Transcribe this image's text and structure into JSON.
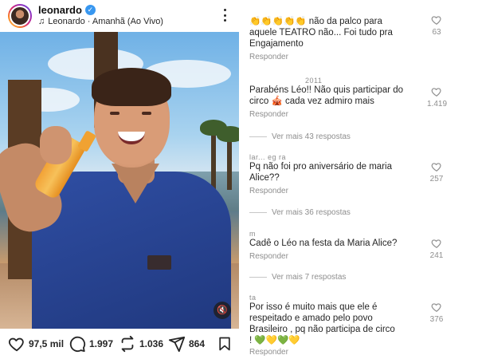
{
  "post": {
    "username": "leonardo",
    "music": "Leonardo · Amanhã (Ao Vivo)",
    "actions": {
      "likes": "97,5 mil",
      "comments": "1.997",
      "reposts": "1.036",
      "shares": "864"
    }
  },
  "comments": [
    {
      "user": "",
      "text": "👏👏👏👏👏 não da palco para aquele TEATRO não... Foi tudo pra Engajamento",
      "reply": "Responder",
      "likes": "63"
    },
    {
      "user": "2011",
      "text": "Parabéns Léo!! Não quis participar do circo 🎪 cada vez admiro mais",
      "reply": "Responder",
      "likes": "1.419",
      "more_replies": "Ver mais 43 respostas"
    },
    {
      "user": "lar... eg ra",
      "text": "Pq não foi pro aniversário de maria Alice??",
      "reply": "Responder",
      "likes": "257",
      "more_replies": "Ver mais 36 respostas"
    },
    {
      "user": "m",
      "text": "Cadê o Léo na festa da Maria Alice?",
      "reply": "Responder",
      "likes": "241",
      "more_replies": "Ver mais 7 respostas"
    },
    {
      "user": "ta",
      "text": "Por isso é muito mais que ele é respeitado e amado pelo povo Brasileiro , pq não participa de circo ! 💚💛💚💛",
      "reply": "Responder",
      "likes": "376"
    }
  ],
  "icons": {
    "like": "heart-icon",
    "comment": "comment-icon",
    "repost": "repost-icon",
    "share": "share-icon",
    "save": "bookmark-icon",
    "mute": "speaker-muted-icon",
    "verified": "verified-badge-icon",
    "music": "music-note-icon"
  },
  "colors": {
    "verified": "#3897f0",
    "text": "#262626",
    "muted_text": "#8e8e8e",
    "shirt": "#2f4ea3"
  }
}
